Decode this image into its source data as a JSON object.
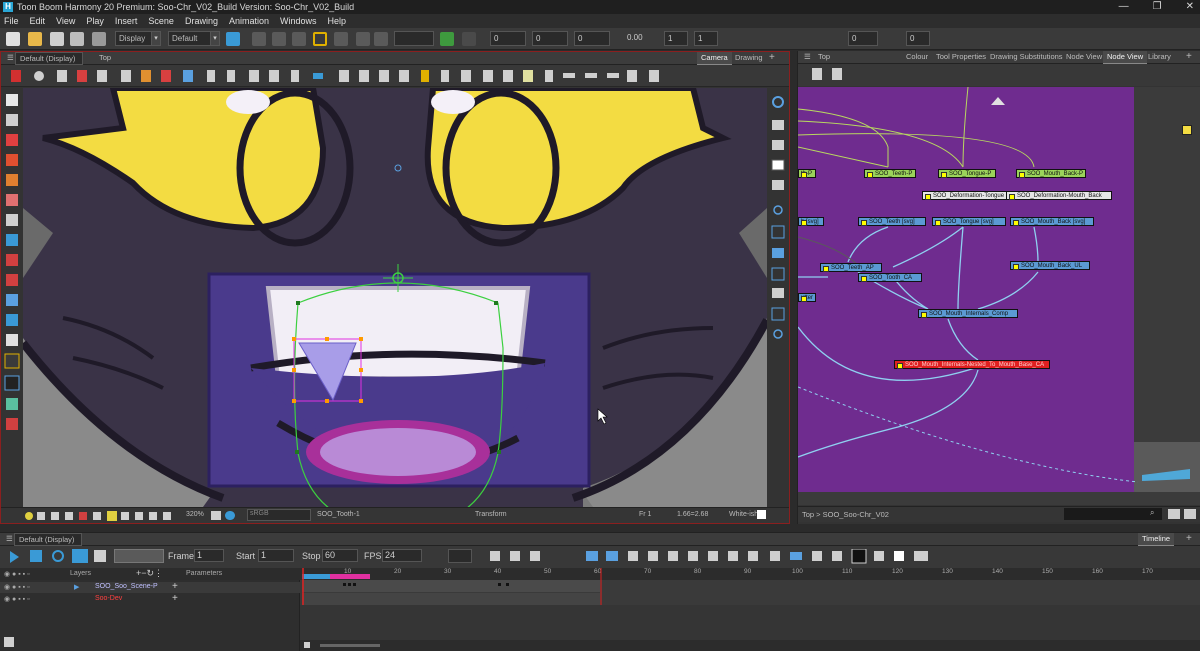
{
  "window": {
    "title": "Toon Boom Harmony 20 Premium: Soo-Chr_V02_Build Version: Soo-Chr_V02_Build",
    "app_icon": "H",
    "controls": [
      "—",
      "❐",
      "✕"
    ]
  },
  "menu": [
    "File",
    "Edit",
    "View",
    "Play",
    "Insert",
    "Scene",
    "Drawing",
    "Animation",
    "Windows",
    "Help"
  ],
  "main_toolbar": {
    "display_combo": "Display",
    "default_combo": "Default",
    "fields": [
      "0",
      "0",
      "0",
      "0.00",
      "1",
      "1",
      "0",
      "0"
    ]
  },
  "camera_panel": {
    "display_combo": "Default (Display)",
    "view_name": "Top",
    "tabs": [
      "Camera",
      "Drawing"
    ],
    "status": {
      "zoom": "320%",
      "color_space": "sRGB",
      "layer": "SOO_Tooth-1",
      "mode": "Transform",
      "frame": "Fr 1",
      "coords": "1.66=2.68",
      "bg": "White-ish"
    }
  },
  "node_panel": {
    "view_name": "Top",
    "tabs": [
      "Colour",
      "Tool Properties",
      "Drawing Substitutions",
      "Node View",
      "Node View",
      "Library"
    ],
    "breadcrumb": "Top  >  SOO_Soo-Chr_V02",
    "nodes": [
      {
        "label": "th-P",
        "color": "green"
      },
      {
        "label": "SOO_Teeth-P",
        "color": "green"
      },
      {
        "label": "SOO_Tongue-P",
        "color": "green"
      },
      {
        "label": "SOO_Mouth_Back-P",
        "color": "green"
      },
      {
        "label": "SOO_Deformation-Tongue",
        "color": "white"
      },
      {
        "label": "SOO_Deformation-Mouth_Back",
        "color": "white"
      },
      {
        "label": "h [svg]",
        "color": "blue"
      },
      {
        "label": "SOO_Teeth [svg]",
        "color": "blue"
      },
      {
        "label": "SOO_Tongue [svg]",
        "color": "blue"
      },
      {
        "label": "SOO_Mouth_Back [svg]",
        "color": "blue"
      },
      {
        "label": "SOO_Teeth_AP",
        "color": "blue"
      },
      {
        "label": "SOO_Tooth_CA",
        "color": "blue"
      },
      {
        "label": "SOO_Mouth_Back_UL",
        "color": "blue"
      },
      {
        "label": "SOO_Mouth_Internals_Comp",
        "color": "blue"
      },
      {
        "label": "SOO_Mouth_Internals-Nested_To_Mouth_Base_CA",
        "color": "red"
      },
      {
        "label": "utter",
        "color": "blue"
      }
    ],
    "colors": {
      "canvas": "#6f2c8f",
      "wire": "#8fd0f0",
      "wire_green": "#b8d860"
    }
  },
  "timeline_panel": {
    "display_combo": "Default (Display)",
    "tab": "Timeline",
    "frame_label": "Frame",
    "frame_value": "1",
    "start_label": "Start",
    "start_value": "1",
    "stop_label": "Stop",
    "stop_value": "60",
    "fps_label": "FPS",
    "fps_value": "24",
    "layers_header": "Layers",
    "params_header": "Parameters",
    "layers": [
      {
        "name": "SOO_Soo_Scene-P",
        "color": "#c0c0ff"
      },
      {
        "name": "Soo-Dev",
        "color": "#ff4040"
      }
    ],
    "ruler": [
      "10",
      "20",
      "30",
      "40",
      "50",
      "60",
      "70",
      "80",
      "90",
      "100",
      "110",
      "120",
      "130",
      "140",
      "150",
      "160",
      "170"
    ]
  }
}
